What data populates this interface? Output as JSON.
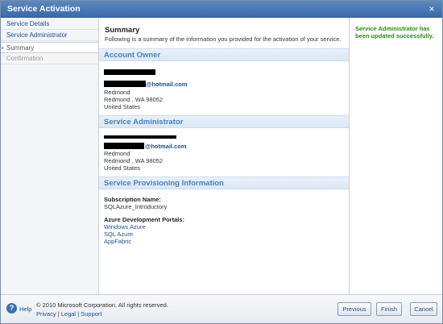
{
  "window": {
    "title": "Service Activation",
    "close_glyph": "×"
  },
  "sidebar": {
    "items": [
      {
        "label": "Service Details",
        "state": "link"
      },
      {
        "label": "Service Administrator",
        "state": "link"
      },
      {
        "label": "Summary",
        "state": "current"
      },
      {
        "label": "Confirmation",
        "state": "disabled"
      }
    ]
  },
  "main": {
    "heading": "Summary",
    "intro": "Following is a summary of the information you provided for the activation of your service.",
    "account_owner": {
      "title": "Account Owner",
      "email_suffix": "@hotmail.com",
      "city": "Redmond",
      "city_state_zip": "Redmond , WA 98052",
      "country": "United States"
    },
    "service_administrator": {
      "title": "Service Administrator",
      "email_suffix": "@hotmail.com",
      "city": "Redmond",
      "city_state_zip": "Redmond , WA 98052",
      "country": "United States"
    },
    "provisioning": {
      "title": "Service Provisioning Information",
      "subscription_label": "Subscription Name:",
      "subscription_value": "SQLAzure_Introductory",
      "portals_label": "Azure Development Portals:",
      "portals": [
        "Windows Azure",
        "SQL Azure",
        "AppFabric"
      ]
    }
  },
  "status": {
    "message": "Service Administrator has been updated successfully.",
    "color": "#2c8a14"
  },
  "footer": {
    "help_label": "Help",
    "copyright": "© 2010 Microsoft Corporation. All rights reserved.",
    "links": [
      "Privacy",
      "Legal",
      "Support"
    ],
    "buttons": {
      "previous": "Previous",
      "finish": "Finish",
      "cancel": "Cancel"
    }
  }
}
